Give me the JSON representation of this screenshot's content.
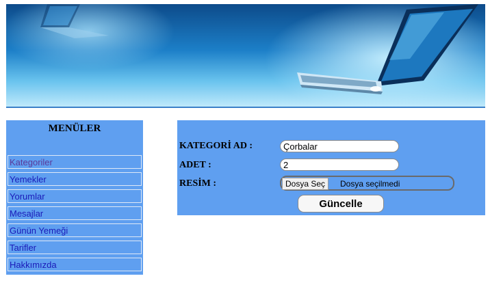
{
  "banner": {
    "alt": "laptop banner"
  },
  "sidebar": {
    "title": "MENÜLER",
    "items": [
      {
        "label": "Kategoriler"
      },
      {
        "label": "Yemekler"
      },
      {
        "label": "Yorumlar"
      },
      {
        "label": "Mesajlar"
      },
      {
        "label": "Günün Yemeği"
      },
      {
        "label": "Tarifler"
      },
      {
        "label": "Hakkımızda"
      }
    ]
  },
  "form": {
    "category_label": "KATEGORİ AD :",
    "category_value": "Çorbalar",
    "count_label": "ADET :",
    "count_value": "2",
    "image_label": "RESİM :",
    "file_button": "Dosya Seç",
    "file_status": "Dosya seçilmedi",
    "submit_label": "Güncelle"
  },
  "colors": {
    "panel_bg": "#5f9ff0",
    "link": "#1a1ab8",
    "visited_link": "#5a3a9a"
  }
}
